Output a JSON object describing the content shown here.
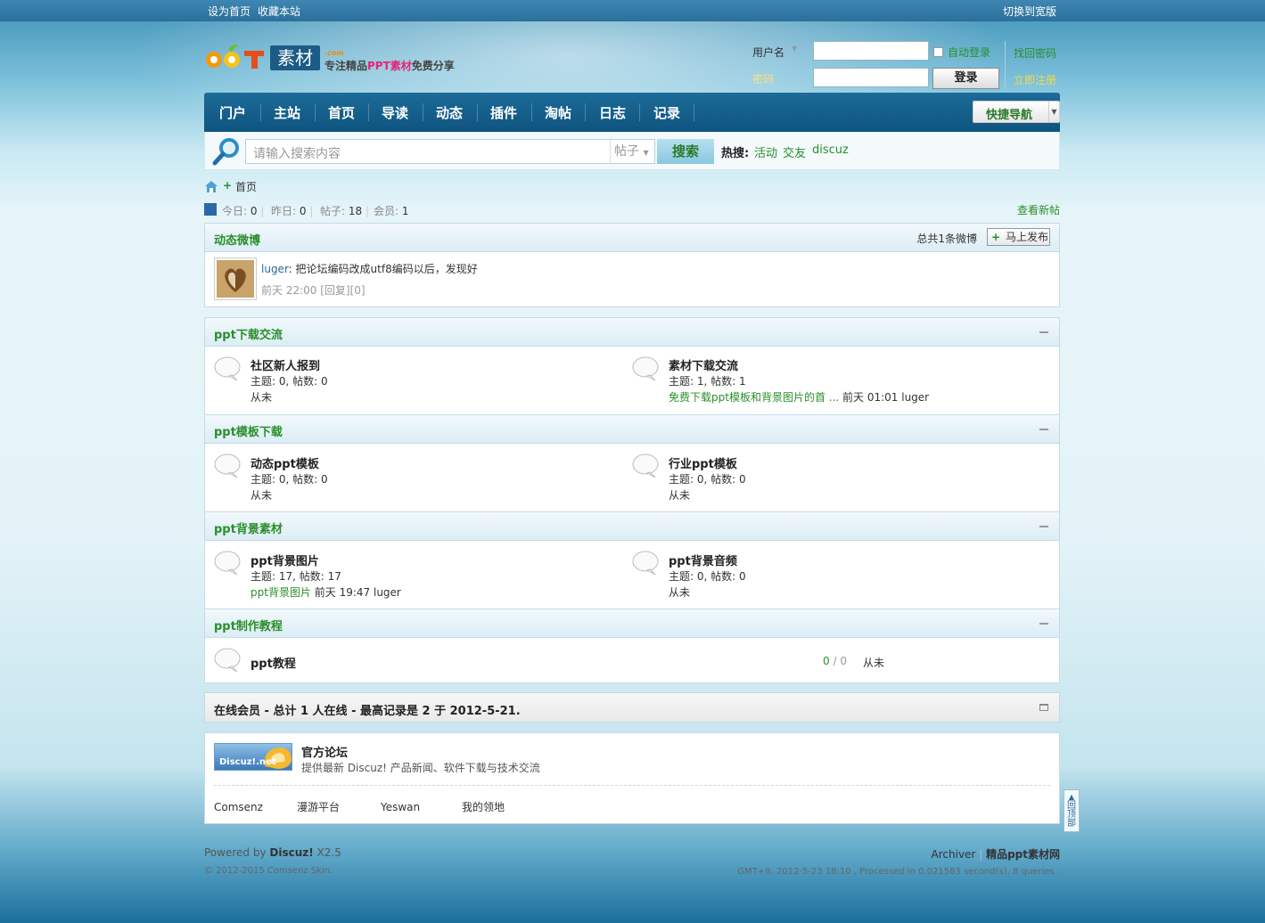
{
  "topbar": {
    "set_home": "设为首页",
    "bookmark": "收藏本站",
    "switch_width": "切换到宽版"
  },
  "logo": {
    "mark_text": "ooT",
    "sucai": "素材",
    "dotcom": ".com",
    "slogan_a": "专注精品",
    "slogan_b": "PPT素材",
    "slogan_c": "免费分享"
  },
  "login": {
    "username_label": "用户名",
    "password_label": "密码",
    "auto_login": "自动登录",
    "login_button": "登录",
    "find_password": "找回密码",
    "register": "立即注册"
  },
  "nav": {
    "items": [
      "门户",
      "主站",
      "首页",
      "导读",
      "动态",
      "插件",
      "淘帖",
      "日志",
      "记录"
    ],
    "quick_nav": "快捷导航"
  },
  "search": {
    "placeholder": "请输入搜索内容",
    "scope": "帖子",
    "button": "搜索",
    "hot_label": "热搜:",
    "hot_terms": [
      "活动",
      "交友",
      "discuz"
    ]
  },
  "breadcrumb": {
    "current": "首页"
  },
  "stats": {
    "today_label": "今日:",
    "today": "0",
    "yesterday_label": "昨日:",
    "yesterday": "0",
    "posts_label": "帖子:",
    "posts": "18",
    "members_label": "会员:",
    "members": "1",
    "new_posts": "查看新帖"
  },
  "weibo": {
    "title": "动态微博",
    "count_text": "总共1条微博",
    "publish_button": "马上发布",
    "post_user": "luger",
    "post_text": ": 把论坛编码改成utf8编码以后，发现好",
    "post_time": "前天 22:00",
    "post_reply": "[回复][0]"
  },
  "categories": [
    {
      "title": "ppt下载交流",
      "forums": [
        {
          "name": "社区新人报到",
          "meta": "主题: 0, 帖数: 0",
          "last": "从未",
          "last_link": "",
          "last_time": ""
        },
        {
          "name": "素材下载交流",
          "meta": "主题: 1, 帖数: 1",
          "last": "",
          "last_link": "免费下载ppt模板和背景图片的首 ...",
          "last_time": " 前天 01:01 luger"
        }
      ]
    },
    {
      "title": "ppt模板下载",
      "forums": [
        {
          "name": "动态ppt模板",
          "meta": "主题: 0, 帖数: 0",
          "last": "从未",
          "last_link": "",
          "last_time": ""
        },
        {
          "name": "行业ppt模板",
          "meta": "主题: 0, 帖数: 0",
          "last": "从未",
          "last_link": "",
          "last_time": ""
        }
      ]
    },
    {
      "title": "ppt背景素材",
      "forums": [
        {
          "name": "ppt背景图片",
          "meta": "主题: 17, 帖数: 17",
          "last": "",
          "last_link": "ppt背景图片",
          "last_time": " 前天 19:47 luger"
        },
        {
          "name": "ppt背景音频",
          "meta": "主题: 0, 帖数: 0",
          "last": "从未",
          "last_link": "",
          "last_time": ""
        }
      ]
    },
    {
      "title": "ppt制作教程",
      "forums": [
        {
          "name": "ppt教程",
          "counts_a": "0",
          "counts_sep": " / ",
          "counts_b": "0",
          "last": "从未"
        }
      ]
    }
  ],
  "online": {
    "title": "在线会员 - 总计 1 人在线 - 最高记录是 2 于 2012-5-21."
  },
  "links": {
    "banner_text": "Discuz!.net",
    "official_title": "官方论坛",
    "official_desc": "提供最新 Discuz! 产品新闻、软件下载与技术交流",
    "text_links": [
      "Comsenz",
      "漫游平台",
      "Yeswan",
      "我的领地"
    ]
  },
  "footer": {
    "powered_by": "Powered by ",
    "discuz": "Discuz!",
    "version": " X2.5",
    "copyright": "© 2012-2015 Comsenz   Skin.",
    "archiver": "Archiver",
    "site_name": "精品ppt素材网",
    "processed": "GMT+8, 2012-5-23 18:10 , Processed in 0.021583 second(s), 8 queries ."
  },
  "totop": "回顶部",
  "colors": {
    "accent_green": "#2a8e2a",
    "nav_blue": "#0f547f"
  }
}
